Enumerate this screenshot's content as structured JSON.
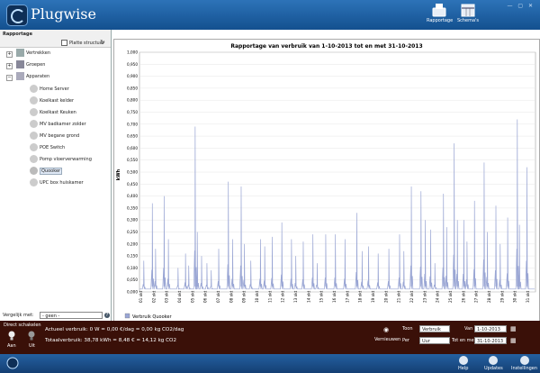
{
  "app": {
    "brand": "Plugwise"
  },
  "toolbar": {
    "rapportage_label": "Rapportage",
    "schemas_label": "Schema's"
  },
  "left": {
    "title": "Rapportage",
    "flat_label": "Platte structuur",
    "tree": [
      "Vertrekken",
      "Groepen",
      "Apparaten",
      "Home Server",
      "Koelkast kelder",
      "Koelkast Keuken",
      "MV badkamer zolder",
      "MV begane grond",
      "POE Switch",
      "Pomp vloerverwarming",
      "Quooker",
      "UPC box huiskamer"
    ],
    "compare_label": "Vergelijk met:",
    "compare_value": "- geen -"
  },
  "chart_data": {
    "type": "line",
    "title": "Rapportage van verbruik van 1-10-2013 tot en met 31-10-2013",
    "ylabel": "kWh",
    "ylim": [
      0,
      1.0
    ],
    "yticks": [
      "0,000",
      "0,050",
      "0,100",
      "0,150",
      "0,200",
      "0,250",
      "0,300",
      "0,350",
      "0,400",
      "0,450",
      "0,500",
      "0,550",
      "0,600",
      "0,650",
      "0,700",
      "0,750",
      "0,800",
      "0,850",
      "0,900",
      "0,950",
      "1,000"
    ],
    "xticks": [
      "01 okt",
      "02 okt",
      "03 okt",
      "04 okt",
      "05 okt",
      "06 okt",
      "07 okt",
      "08 okt",
      "09 okt",
      "10 okt",
      "11 okt",
      "12 okt",
      "13 okt",
      "14 okt",
      "15 okt",
      "16 okt",
      "17 okt",
      "18 okt",
      "19 okt",
      "20 okt",
      "21 okt",
      "22 okt",
      "23 okt",
      "24 okt",
      "25 okt",
      "26 okt",
      "27 okt",
      "28 okt",
      "29 okt",
      "30 okt",
      "31 okt"
    ],
    "color": "#9aa6d4",
    "series": [
      {
        "name": "Verbruik Quooker"
      }
    ],
    "peaks": [
      {
        "day": 0.4,
        "v": 0.13
      },
      {
        "day": 1.2,
        "v": 0.37
      },
      {
        "day": 1.5,
        "v": 0.18
      },
      {
        "day": 2.3,
        "v": 0.4
      },
      {
        "day": 2.7,
        "v": 0.22
      },
      {
        "day": 3.6,
        "v": 0.1
      },
      {
        "day": 4.3,
        "v": 0.16
      },
      {
        "day": 4.6,
        "v": 0.11
      },
      {
        "day": 5.2,
        "v": 0.69
      },
      {
        "day": 5.4,
        "v": 0.25
      },
      {
        "day": 5.8,
        "v": 0.15
      },
      {
        "day": 6.3,
        "v": 0.12
      },
      {
        "day": 6.7,
        "v": 0.09
      },
      {
        "day": 7.4,
        "v": 0.18
      },
      {
        "day": 8.3,
        "v": 0.46
      },
      {
        "day": 8.7,
        "v": 0.22
      },
      {
        "day": 9.5,
        "v": 0.44
      },
      {
        "day": 9.8,
        "v": 0.2
      },
      {
        "day": 10.4,
        "v": 0.13
      },
      {
        "day": 11.3,
        "v": 0.22
      },
      {
        "day": 11.7,
        "v": 0.19
      },
      {
        "day": 12.4,
        "v": 0.23
      },
      {
        "day": 13.3,
        "v": 0.29
      },
      {
        "day": 14.2,
        "v": 0.22
      },
      {
        "day": 14.6,
        "v": 0.15
      },
      {
        "day": 15.3,
        "v": 0.21
      },
      {
        "day": 16.2,
        "v": 0.24
      },
      {
        "day": 16.6,
        "v": 0.12
      },
      {
        "day": 17.4,
        "v": 0.24
      },
      {
        "day": 18.3,
        "v": 0.24
      },
      {
        "day": 19.2,
        "v": 0.22
      },
      {
        "day": 20.3,
        "v": 0.33
      },
      {
        "day": 20.8,
        "v": 0.17
      },
      {
        "day": 21.4,
        "v": 0.19
      },
      {
        "day": 22.3,
        "v": 0.16
      },
      {
        "day": 23.3,
        "v": 0.18
      },
      {
        "day": 24.3,
        "v": 0.24
      },
      {
        "day": 24.7,
        "v": 0.17
      },
      {
        "day": 25.4,
        "v": 0.44
      },
      {
        "day": 26.3,
        "v": 0.42
      },
      {
        "day": 26.7,
        "v": 0.3
      },
      {
        "day": 27.2,
        "v": 0.26
      },
      {
        "day": 27.6,
        "v": 0.12
      },
      {
        "day": 28.4,
        "v": 0.41
      },
      {
        "day": 28.7,
        "v": 0.27
      },
      {
        "day": 29.4,
        "v": 0.62
      },
      {
        "day": 29.7,
        "v": 0.3
      },
      {
        "day": 30.3,
        "v": 0.3
      },
      {
        "day": 30.6,
        "v": 0.21
      },
      {
        "day": 31.3,
        "v": 0.38
      },
      {
        "day": 32.2,
        "v": 0.54
      },
      {
        "day": 32.5,
        "v": 0.25
      },
      {
        "day": 33.3,
        "v": 0.36
      },
      {
        "day": 33.7,
        "v": 0.2
      },
      {
        "day": 34.4,
        "v": 0.31
      },
      {
        "day": 35.3,
        "v": 0.72
      },
      {
        "day": 35.5,
        "v": 0.28
      },
      {
        "day": 36.2,
        "v": 0.52
      }
    ]
  },
  "bottom": {
    "direct_label": "Direct schakelen",
    "aan_label": "Aan",
    "uit_label": "Uit",
    "actual_text": "Actueel verbruik: 0 W = 0,00 €/dag = 0,00 kg CO2/dag",
    "total_text": "Totaalverbruik: 38,78 kWh = 8,48 € = 14,12 kg CO2",
    "toon_label": "Toon",
    "toon_value": "Verbruik",
    "per_label": "Per",
    "per_value": "Uur",
    "vernieuwen_label": "Vernieuwen",
    "van_label": "Van",
    "van_value": "1-10-2013",
    "totenmet_label": "Tot en met",
    "totenmet_value": "31-10-2013"
  },
  "footer": {
    "help_label": "Help",
    "updates_label": "Updates",
    "installingen_label": "Instellingen"
  }
}
